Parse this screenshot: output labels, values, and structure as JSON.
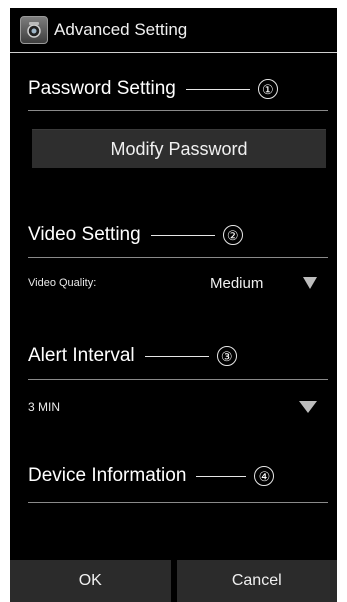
{
  "window": {
    "title": "Advanced Setting"
  },
  "sections": {
    "password": {
      "title": "Password Setting",
      "badge": "①",
      "button": "Modify Password"
    },
    "video": {
      "title": "Video Setting",
      "badge": "②",
      "quality_label": "Video Quality:",
      "quality_value": "Medium"
    },
    "alert": {
      "title": "Alert Interval",
      "badge": "③",
      "value": "3 MIN"
    },
    "device": {
      "title": "Device Information",
      "badge": "④"
    }
  },
  "footer": {
    "ok": "OK",
    "cancel": "Cancel"
  },
  "colors": {
    "background": "#000000",
    "text": "#ffffff",
    "divider": "#8a8a8a",
    "button": "#2e2e2e"
  },
  "icons": {
    "app": "camera-app-icon",
    "dropdown": "dropdown-triangle-icon"
  }
}
